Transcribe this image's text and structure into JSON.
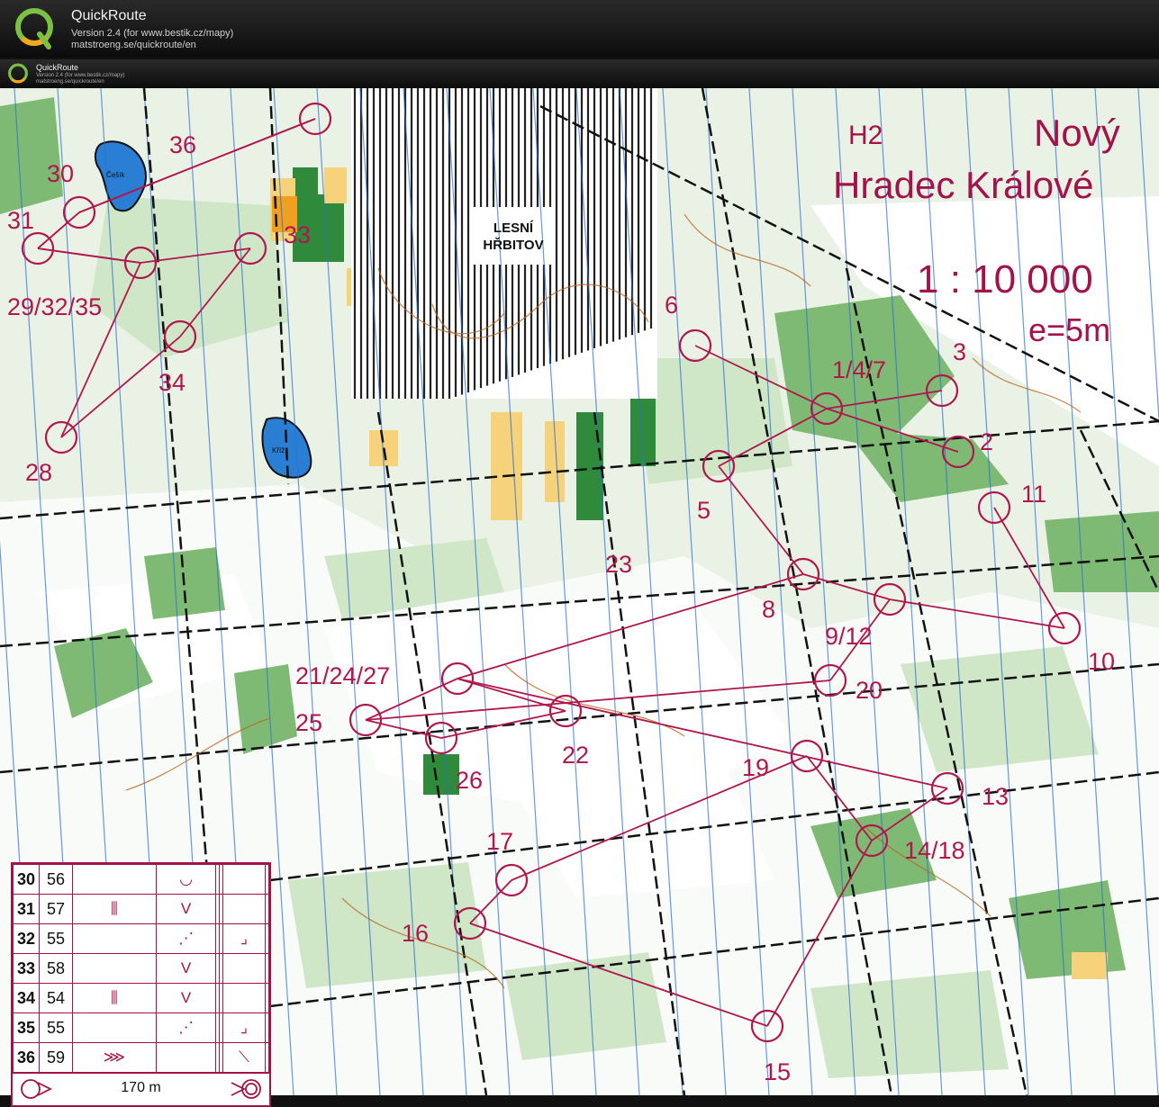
{
  "app": {
    "name": "QuickRoute",
    "version": "Version 2.4  (for www.bestik.cz/mapy)",
    "url": "matstroeng.se/quickroute/en",
    "logo_letter": "Q"
  },
  "map": {
    "category": "H2",
    "title_line1": "Nový",
    "title_line2": "Hradec Králové",
    "scale": "1 : 10 000",
    "equidistance": "e=5m",
    "cemetery_line1": "LESNÍ",
    "cemetery_line2": "HŘBITOV",
    "lake_north": "Češík",
    "lake_south": "Kříž",
    "controls": [
      "30",
      "36",
      "31",
      "33",
      "29/32/35",
      "34",
      "28",
      "6",
      "3",
      "1/4/7",
      "2",
      "5",
      "11",
      "23",
      "8",
      "9/12",
      "10",
      "21/24/27",
      "20",
      "25",
      "22",
      "26",
      "19",
      "13",
      "17",
      "14/18",
      "16",
      "15"
    ]
  },
  "description": {
    "rows": [
      {
        "num": "30",
        "code": "56",
        "c3": "",
        "c4": "◡",
        "c5": "",
        "c6": "",
        "c7": "",
        "c8": ""
      },
      {
        "num": "31",
        "code": "57",
        "c3": "⫼",
        "c4": "V",
        "c5": "",
        "c6": "",
        "c7": "",
        "c8": ""
      },
      {
        "num": "32",
        "code": "55",
        "c3": "",
        "c4": "⋰",
        "c5": "",
        "c6": "",
        "c7": "⌟",
        "c8": ""
      },
      {
        "num": "33",
        "code": "58",
        "c3": "",
        "c4": "V",
        "c5": "",
        "c6": "",
        "c7": "",
        "c8": ""
      },
      {
        "num": "34",
        "code": "54",
        "c3": "⫼",
        "c4": "V",
        "c5": "",
        "c6": "",
        "c7": "",
        "c8": ""
      },
      {
        "num": "35",
        "code": "55",
        "c3": "",
        "c4": "⋰",
        "c5": "",
        "c6": "",
        "c7": "⌟",
        "c8": ""
      },
      {
        "num": "36",
        "code": "59",
        "c3": "⋙",
        "c4": "",
        "c5": "",
        "c6": "",
        "c7": "⟍",
        "c8": ""
      }
    ],
    "finish_length": "170 m"
  },
  "colors": {
    "course": "#b0174f",
    "forest_white": "#ffffff",
    "green": "#5aa05a",
    "yellow": "#f7d77a",
    "water": "#2a7fd4"
  }
}
